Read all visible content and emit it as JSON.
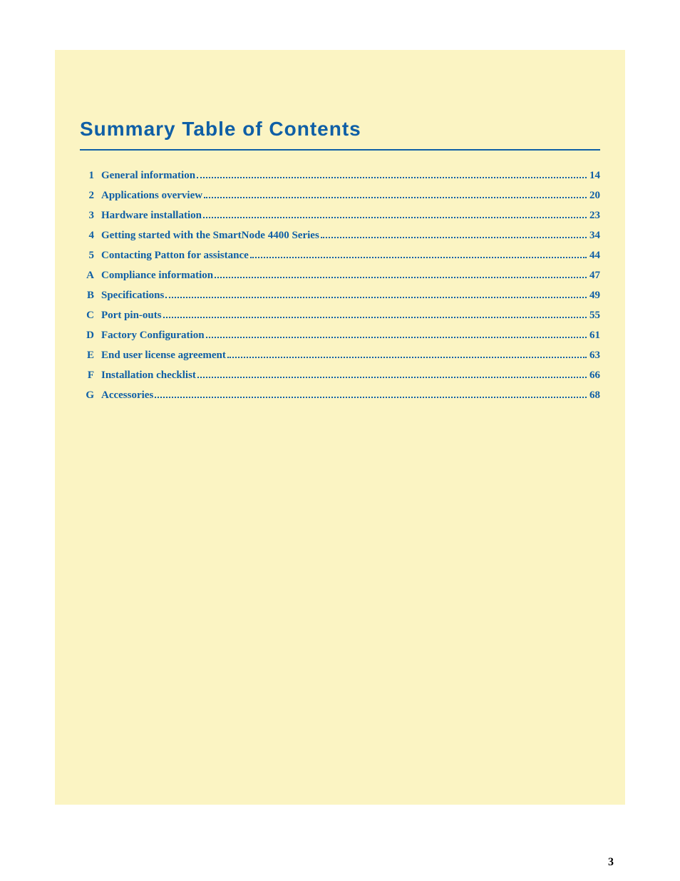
{
  "title": "Summary Table of Contents",
  "page_number": "3",
  "toc": [
    {
      "num": "1",
      "title": "General information",
      "page": "14"
    },
    {
      "num": "2",
      "title": "Applications overview",
      "page": "20"
    },
    {
      "num": "3",
      "title": "Hardware installation",
      "page": "23"
    },
    {
      "num": "4",
      "title": "Getting started with the SmartNode 4400 Series",
      "page": "34"
    },
    {
      "num": "5",
      "title": "Contacting Patton for assistance",
      "page": "44"
    },
    {
      "num": "A",
      "title": "Compliance information",
      "page": "47"
    },
    {
      "num": "B",
      "title": "Specifications",
      "page": "49"
    },
    {
      "num": "C",
      "title": "Port pin-outs",
      "page": "55"
    },
    {
      "num": "D",
      "title": "Factory Configuration",
      "page": "61"
    },
    {
      "num": "E",
      "title": "End user license agreement",
      "page": "63"
    },
    {
      "num": "F",
      "title": "Installation checklist",
      "page": "66"
    },
    {
      "num": "G",
      "title": "Accessories",
      "page": "68"
    }
  ]
}
